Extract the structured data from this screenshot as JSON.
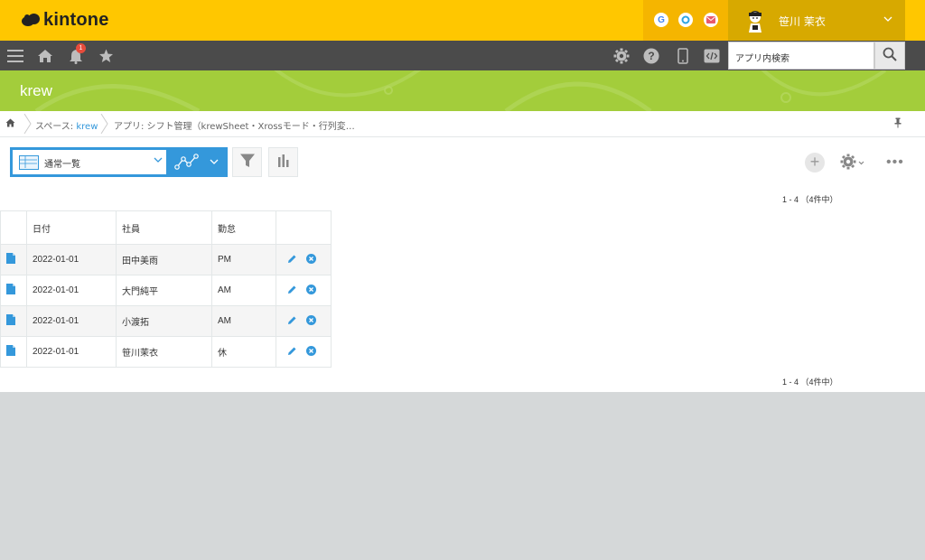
{
  "header": {
    "logo_text": "kintone",
    "service_icons": [
      {
        "name": "google-icon",
        "glyph": "G",
        "color": "#4285f4"
      },
      {
        "name": "garoon-icon",
        "glyph": "○",
        "color": "#2fa5e0"
      },
      {
        "name": "mail-icon",
        "glyph": "✉",
        "color": "#e95a6b"
      }
    ],
    "user_name": "笹川 茉衣"
  },
  "navbar": {
    "notification_count": "1",
    "search_placeholder": "アプリ内検索"
  },
  "space": {
    "title": "krew"
  },
  "breadcrumb": {
    "space_prefix": "スペース:",
    "space_name": "krew",
    "app": "アプリ: シフト管理（krewSheet・Xrossモード・行列変…"
  },
  "toolbar": {
    "view_name": "通常一覧"
  },
  "pager": {
    "top": "1 - 4 （4件中）",
    "bottom": "1 - 4 （4件中）"
  },
  "table": {
    "columns": [
      "日付",
      "社員",
      "勤怠"
    ],
    "rows": [
      {
        "date": "2022-01-01",
        "employee": "田中美雨",
        "attendance": "PM"
      },
      {
        "date": "2022-01-01",
        "employee": "大門純平",
        "attendance": "AM"
      },
      {
        "date": "2022-01-01",
        "employee": "小渡拓",
        "attendance": "AM"
      },
      {
        "date": "2022-01-01",
        "employee": "笹川茉衣",
        "attendance": "休"
      }
    ]
  },
  "colors": {
    "header_yellow": "#ffc700",
    "nav_dark": "#4b4b4b",
    "space_green": "#a3cd3b",
    "accent_blue": "#3498db"
  }
}
